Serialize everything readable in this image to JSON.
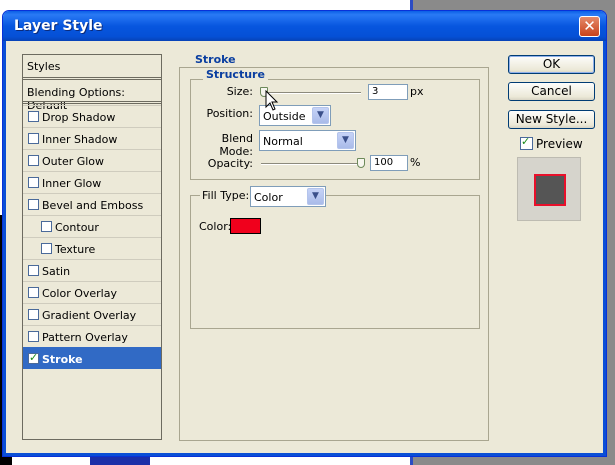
{
  "window": {
    "title": "Layer Style",
    "close_glyph": "✕"
  },
  "styles_list": {
    "header": "Styles",
    "blending": "Blending Options: Default",
    "items": [
      {
        "label": "Drop Shadow",
        "checked": false,
        "indent": false
      },
      {
        "label": "Inner Shadow",
        "checked": false,
        "indent": false
      },
      {
        "label": "Outer Glow",
        "checked": false,
        "indent": false
      },
      {
        "label": "Inner Glow",
        "checked": false,
        "indent": false
      },
      {
        "label": "Bevel and Emboss",
        "checked": false,
        "indent": false
      },
      {
        "label": "Contour",
        "checked": false,
        "indent": true
      },
      {
        "label": "Texture",
        "checked": false,
        "indent": true
      },
      {
        "label": "Satin",
        "checked": false,
        "indent": false
      },
      {
        "label": "Color Overlay",
        "checked": false,
        "indent": false
      },
      {
        "label": "Gradient Overlay",
        "checked": false,
        "indent": false
      },
      {
        "label": "Pattern Overlay",
        "checked": false,
        "indent": false
      },
      {
        "label": "Stroke",
        "checked": true,
        "indent": false,
        "selected": true
      }
    ]
  },
  "stroke": {
    "title": "Stroke",
    "structure_title": "Structure",
    "size_label": "Size:",
    "size_value": "3",
    "size_unit": "px",
    "size_slider_fraction": 0.03,
    "position_label": "Position:",
    "position_value": "Outside",
    "blend_label": "Blend Mode:",
    "blend_value": "Normal",
    "opacity_label": "Opacity:",
    "opacity_value": "100",
    "opacity_unit": "%",
    "opacity_slider_fraction": 1.0,
    "fill_type_label": "Fill Type:",
    "fill_type_value": "Color",
    "color_label": "Color:",
    "color_value": "#f0001c"
  },
  "buttons": {
    "ok": "OK",
    "cancel": "Cancel",
    "new_style": "New Style...",
    "preview_label": "Preview",
    "preview_checked": true
  },
  "colors": {
    "titlebar": "#0a5fe6",
    "selection": "#316ac5",
    "group_title": "#0a3ea0",
    "stroke_color": "#f0001c"
  }
}
